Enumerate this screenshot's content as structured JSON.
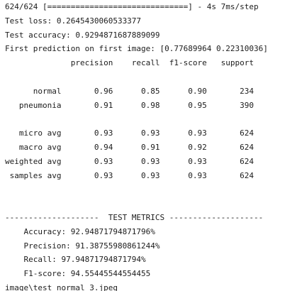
{
  "output": {
    "progress_line": "624/624 [==============================] - 4s 7ms/step",
    "test_loss_line": "Test loss: 0.2645430060533377",
    "test_accuracy_line": "Test accuracy: 0.9294871687889099",
    "first_prediction_line": "First prediction on first image: [0.77689964 0.22310036]",
    "report": {
      "header": "              precision    recall  f1-score   support",
      "rows": [
        "      normal       0.96      0.85      0.90       234",
        "   pneumonia       0.91      0.98      0.95       390"
      ],
      "averages": [
        "   micro avg       0.93      0.93      0.93       624",
        "   macro avg       0.94      0.91      0.92       624",
        "weighted avg       0.93      0.93      0.93       624",
        " samples avg       0.93      0.93      0.93       624"
      ]
    },
    "metrics": {
      "banner": "--------------------  TEST METRICS --------------------",
      "accuracy": "    Accuracy: 92.94871794871796%",
      "precision": "    Precision: 91.38755980861244%",
      "recall": "    Recall: 97.94871794871794%",
      "f1": "    F1-score: 94.55445544554455"
    },
    "truncated_line": "image\\test_normal_3.jpeg"
  }
}
